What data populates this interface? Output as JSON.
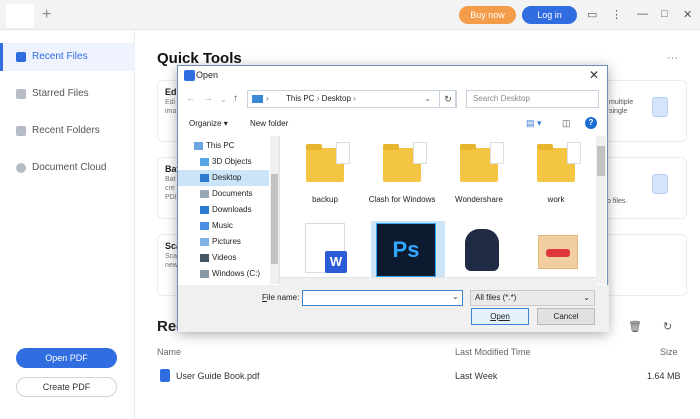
{
  "header": {
    "buy_now": "Buy now",
    "log_in": "Log in"
  },
  "sidebar": {
    "items": [
      {
        "label": "Recent Files"
      },
      {
        "label": "Starred Files"
      },
      {
        "label": "Recent Folders"
      },
      {
        "label": "Document Cloud"
      }
    ],
    "open_pdf": "Open PDF",
    "create_pdf": "Create PDF"
  },
  "main": {
    "quick_tools_title": "Quick Tools",
    "card1": {
      "title": "Edi",
      "lines": [
        "Edi",
        "ima"
      ],
      "right": [
        "multiple",
        "single"
      ]
    },
    "card2": {
      "title": "Bat",
      "lines": [
        "Bat",
        "cre",
        "PDI"
      ],
      "right": [
        "wo files."
      ]
    },
    "card3": {
      "title": "Sca",
      "lines": [
        "Sca",
        "new"
      ]
    },
    "recent_title": "Rec",
    "columns": {
      "name": "Name",
      "modified": "Last Modified Time",
      "size": "Size"
    },
    "files": [
      {
        "name": "User Guide Book.pdf",
        "modified": "Last Week",
        "size": "1.64 MB"
      }
    ]
  },
  "dialog": {
    "title": "Open",
    "path": [
      "This PC",
      "Desktop"
    ],
    "search_placeholder": "Search Desktop",
    "organize": "Organize",
    "new_folder": "New folder",
    "tree": [
      {
        "label": "This PC"
      },
      {
        "label": "3D Objects"
      },
      {
        "label": "Desktop"
      },
      {
        "label": "Documents"
      },
      {
        "label": "Downloads"
      },
      {
        "label": "Music"
      },
      {
        "label": "Pictures"
      },
      {
        "label": "Videos"
      },
      {
        "label": "Windows (C:)"
      }
    ],
    "files": [
      {
        "label": "backup"
      },
      {
        "label": "Clash for Windows"
      },
      {
        "label": "Wondershare"
      },
      {
        "label": "work"
      },
      {
        "label": "W"
      },
      {
        "label": "Ps"
      }
    ],
    "file_name_label": "File name:",
    "file_name_value": "",
    "filter": "All files (*.*)",
    "open_button": "Open",
    "cancel_button": "Cancel"
  }
}
